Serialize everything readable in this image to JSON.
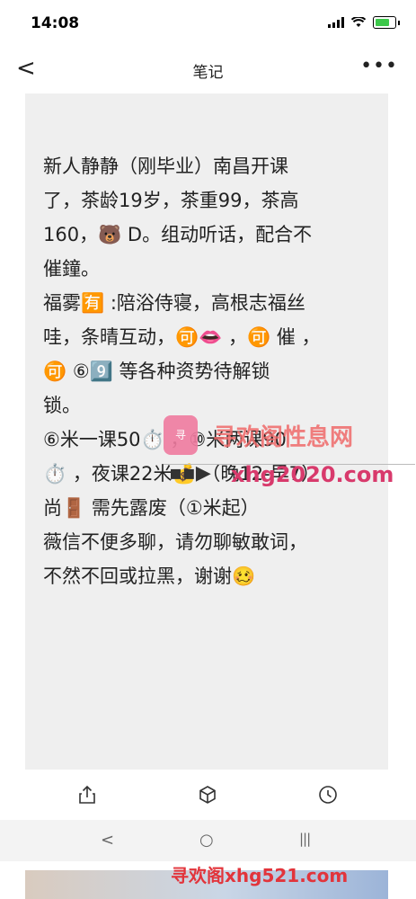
{
  "status_bar": {
    "time": "14:08"
  },
  "header": {
    "back_glyph": "<",
    "title": "笔记",
    "more_glyph": "•••"
  },
  "note": {
    "lines": [
      "新人静静（刚毕业）南昌开课",
      "了，茶龄19岁，茶重99，茶高",
      "160，🐻 D。组动听话，配合不",
      "催鐘。",
      "福雾🈶 :陪浴侍寝，高根志福丝",
      "哇，条晴互动，🉑👄 ，🉑 催 ，",
      "🉑 ⑥9️⃣ 等各种资势待解锁",
      "锁。",
      "⑥米一课50⏱️ ，⑩米两课90",
      "⏱️ ，夜课22米💰 （晚12-早7）",
      "尚🚪 需先露废（①米起）",
      "薇信不便多聊，请勿聊敏敢词，",
      "不然不回或拉黑，谢谢🥴"
    ]
  },
  "toolbar": {
    "icons": [
      "share-icon",
      "cube-icon",
      "clock-icon"
    ]
  },
  "system_nav": {
    "back": "<",
    "home": "○",
    "recents": "|||"
  },
  "watermarks": {
    "site_name": "寻欢阁性息网",
    "domain_1": "xhg2020.com",
    "bottom": "寻欢阁xhg521.com"
  }
}
